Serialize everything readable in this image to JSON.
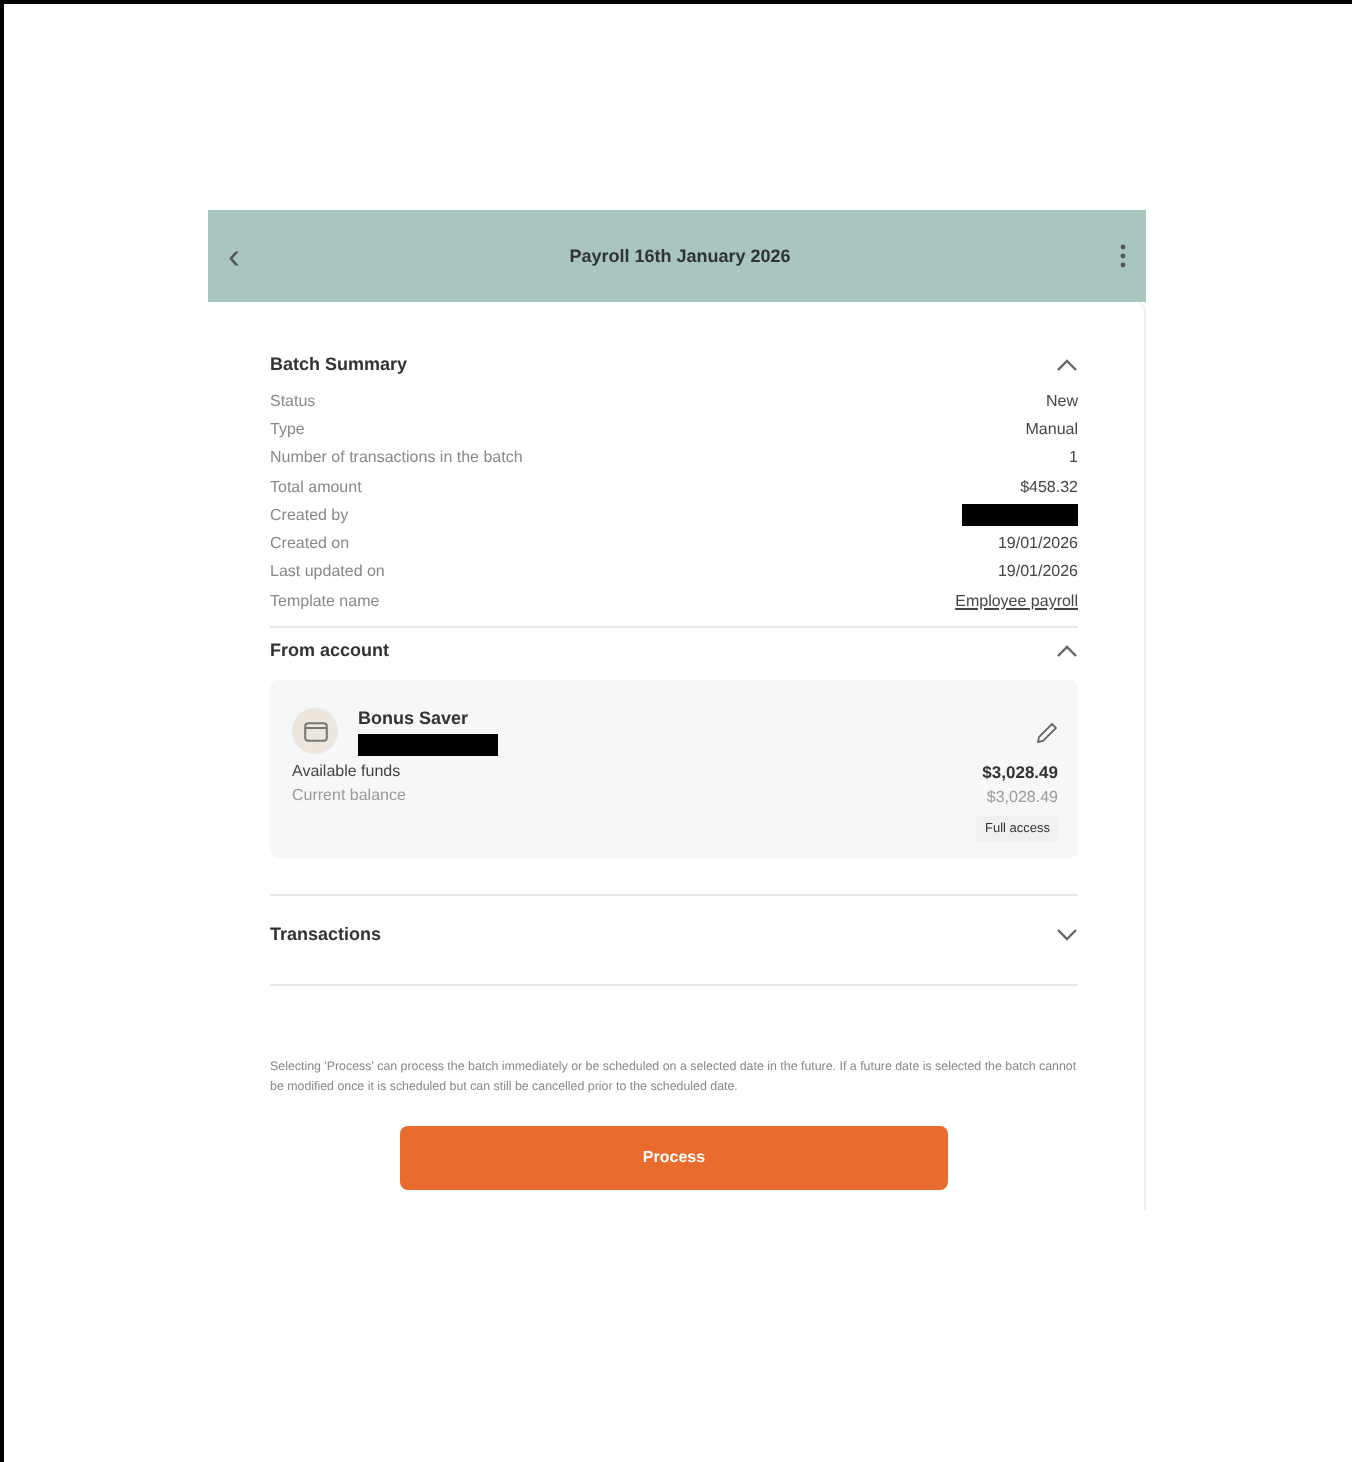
{
  "header": {
    "back": "‹",
    "title": "Payroll 16th January 2026"
  },
  "sections": [
    {
      "kind": "summary",
      "title": "Batch Summary",
      "expanded": true,
      "rows": [
        {
          "label": "Status",
          "value": "New",
          "kind": "text"
        },
        {
          "label": "Type",
          "value": "Manual",
          "kind": "text"
        },
        {
          "label": "Number of transactions in the batch",
          "value": "1",
          "kind": "text"
        },
        {
          "label": "Total amount",
          "value": "$458.32",
          "kind": "text"
        },
        {
          "label": "Created by",
          "kind": "redacted"
        },
        {
          "label": "Created on",
          "value": "19/01/2026",
          "kind": "text"
        },
        {
          "label": "Last updated on",
          "value": "19/01/2026",
          "kind": "text"
        },
        {
          "label": "Template name",
          "value": "Employee payroll",
          "kind": "link"
        }
      ]
    },
    {
      "kind": "account",
      "title": "From account",
      "expanded": true,
      "account": {
        "name": "Bonus Saver",
        "number_redacted": true,
        "available_label": "Available funds",
        "available": "$3,028.49",
        "balance_label": "Current balance",
        "balance": "$3,028.49",
        "access": "Full access"
      }
    },
    {
      "kind": "list",
      "title": "Transactions",
      "expanded": false
    }
  ],
  "note": "Selecting 'Process' can process the batch immediately or be scheduled on a selected date in the future. If a future date is selected the batch cannot be modified once it is scheduled but can still be cancelled prior to the scheduled date.",
  "button": "Process"
}
